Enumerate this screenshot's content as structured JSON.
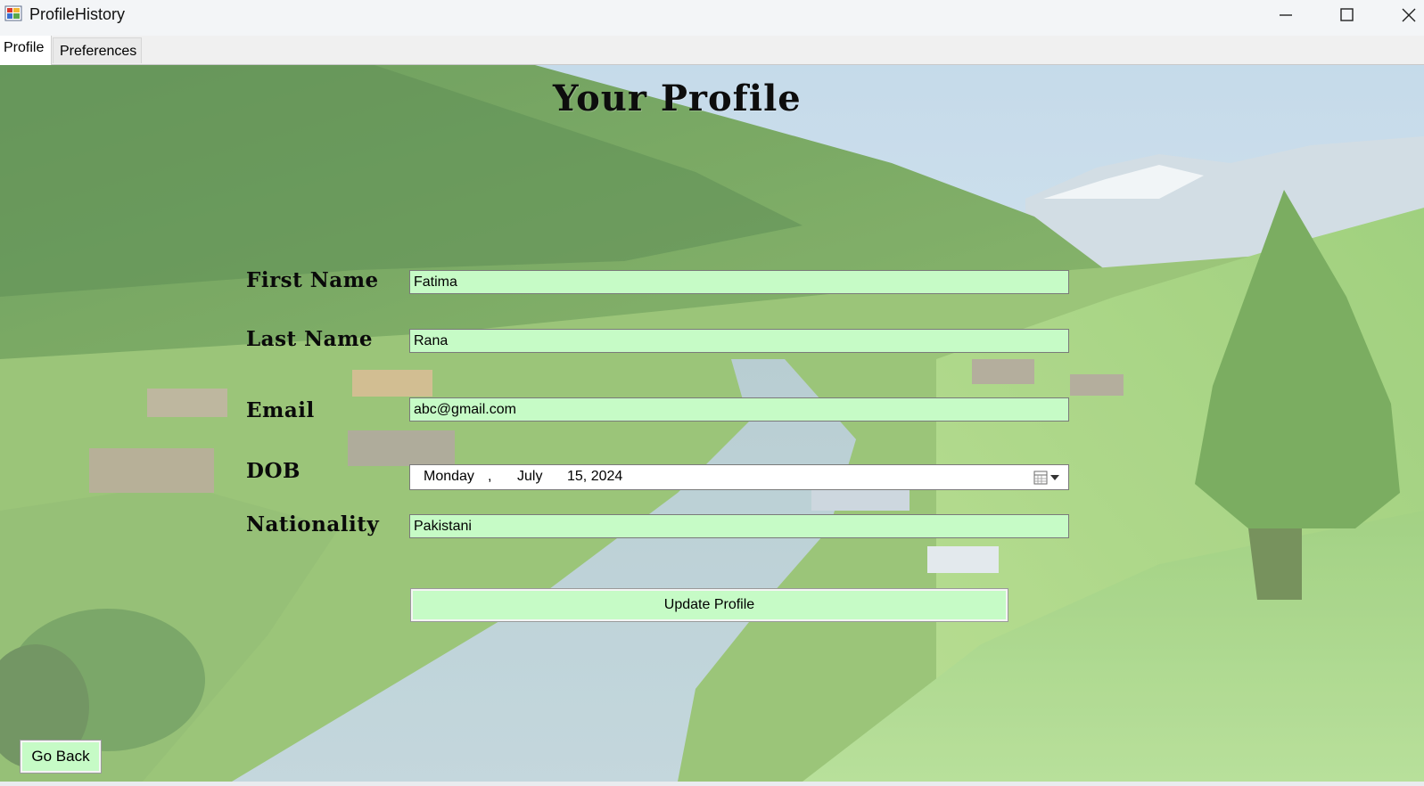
{
  "window": {
    "title": "ProfileHistory"
  },
  "tabs": [
    {
      "label": "Profile",
      "selected": true
    },
    {
      "label": "Preferences",
      "selected": false
    }
  ],
  "profile": {
    "heading": "Your Profile",
    "first_name": {
      "label": "First Name",
      "value": "Fatima"
    },
    "last_name": {
      "label": "Last Name",
      "value": "Rana"
    },
    "email": {
      "label": "Email",
      "value": "abc@gmail.com"
    },
    "dob": {
      "label": "DOB",
      "weekday": "Monday",
      "separator": ",",
      "month": "July",
      "day_year": "15, 2024"
    },
    "nationality": {
      "label": "Nationality",
      "value": "Pakistani"
    },
    "update_button": "Update Profile",
    "back_button": "Go Back"
  },
  "colors": {
    "field_bg": "#c6fbc6",
    "text": "#000000"
  },
  "icons": [
    "app-icon",
    "minimize-icon",
    "maximize-icon",
    "close-icon",
    "calendar-icon",
    "dropdown-arrow-icon"
  ]
}
